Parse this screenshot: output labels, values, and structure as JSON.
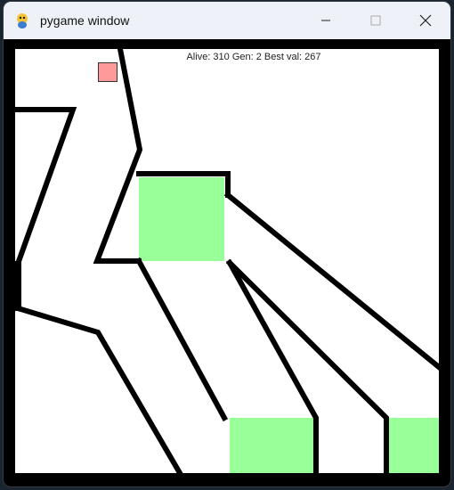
{
  "window": {
    "title": "pygame window",
    "icons": {
      "app": "pygame-snake-icon",
      "minimize": "minimize-icon",
      "maximize": "maximize-icon",
      "close": "close-icon"
    }
  },
  "hud": {
    "text": "Alive: 310 Gen: 2 Best val: 267"
  },
  "colors": {
    "wall": "#000000",
    "goal": "#99ff99",
    "player": "#ff9a9a",
    "background": "#ffffff"
  }
}
